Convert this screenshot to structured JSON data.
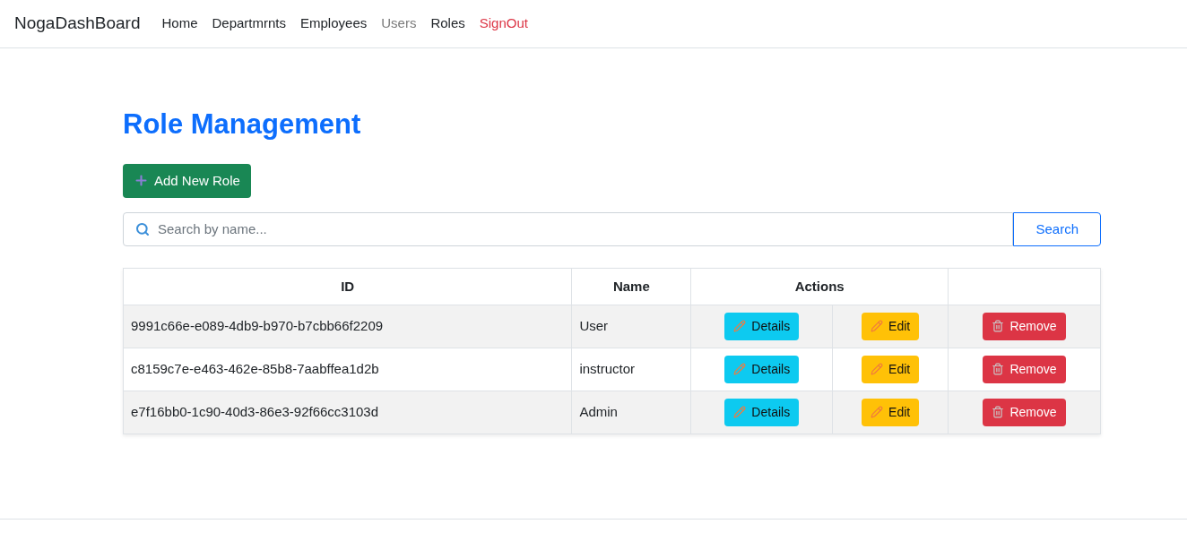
{
  "navbar": {
    "brand": "NogaDashBoard",
    "links": [
      {
        "label": "Home",
        "kind": "normal"
      },
      {
        "label": "Departmrnts",
        "kind": "normal"
      },
      {
        "label": "Employees",
        "kind": "normal"
      },
      {
        "label": "Users",
        "kind": "muted"
      },
      {
        "label": "Roles",
        "kind": "normal"
      },
      {
        "label": "SignOut",
        "kind": "danger"
      }
    ]
  },
  "heading": "Role Management",
  "add_button": "Add New Role",
  "search": {
    "placeholder": "Search by name...",
    "button": "Search"
  },
  "table": {
    "columns": [
      "ID",
      "Name",
      "Actions"
    ],
    "rows": [
      {
        "id": "9991c66e-e089-4db9-b970-b7cbb66f2209",
        "name": "User",
        "actions": [
          "Details",
          "Edit",
          "Remove"
        ]
      },
      {
        "id": "c8159c7e-e463-462e-85b8-7aabffea1d2b",
        "name": "instructor",
        "actions": [
          "Details",
          "Edit",
          "Remove"
        ]
      },
      {
        "id": "e7f16bb0-1c90-40d3-86e3-92f66cc3103d",
        "name": "Admin",
        "actions": [
          "Details",
          "Edit",
          "Remove"
        ]
      }
    ]
  }
}
